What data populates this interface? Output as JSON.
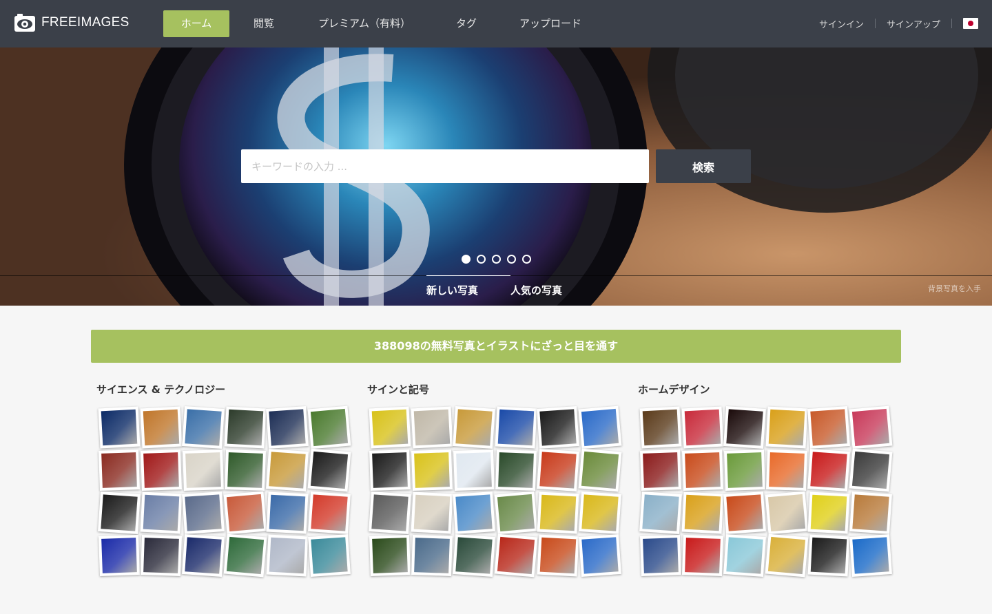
{
  "header": {
    "logo_text": "FREEIMAGES",
    "logo_icon": "camera-eye-icon",
    "nav": {
      "home": "ホーム",
      "browse": "閲覧",
      "premium": "プレミアム（有料）",
      "tags": "タグ",
      "upload": "アップロード"
    },
    "auth": {
      "signin": "サインイン",
      "signup": "サインアップ",
      "language_flag": "japan-flag-icon"
    }
  },
  "hero": {
    "search_placeholder": "キーワードの入力 ...",
    "search_button": "検索",
    "slide_count": 5,
    "active_slide": 1,
    "tabs": {
      "new": "新しい写真",
      "popular": "人気の写真"
    },
    "background_link": "背景写真を入手"
  },
  "main": {
    "banner": "388098の無料写真とイラストにざっと目を通す",
    "categories": [
      {
        "title": "サイエンス & テクノロジー"
      },
      {
        "title": "サインと記号"
      },
      {
        "title": "ホームデザイン"
      }
    ]
  },
  "colors": {
    "header_bg": "#3b4049",
    "accent_green": "#a6c15f",
    "page_bg": "#f6f6f6"
  }
}
